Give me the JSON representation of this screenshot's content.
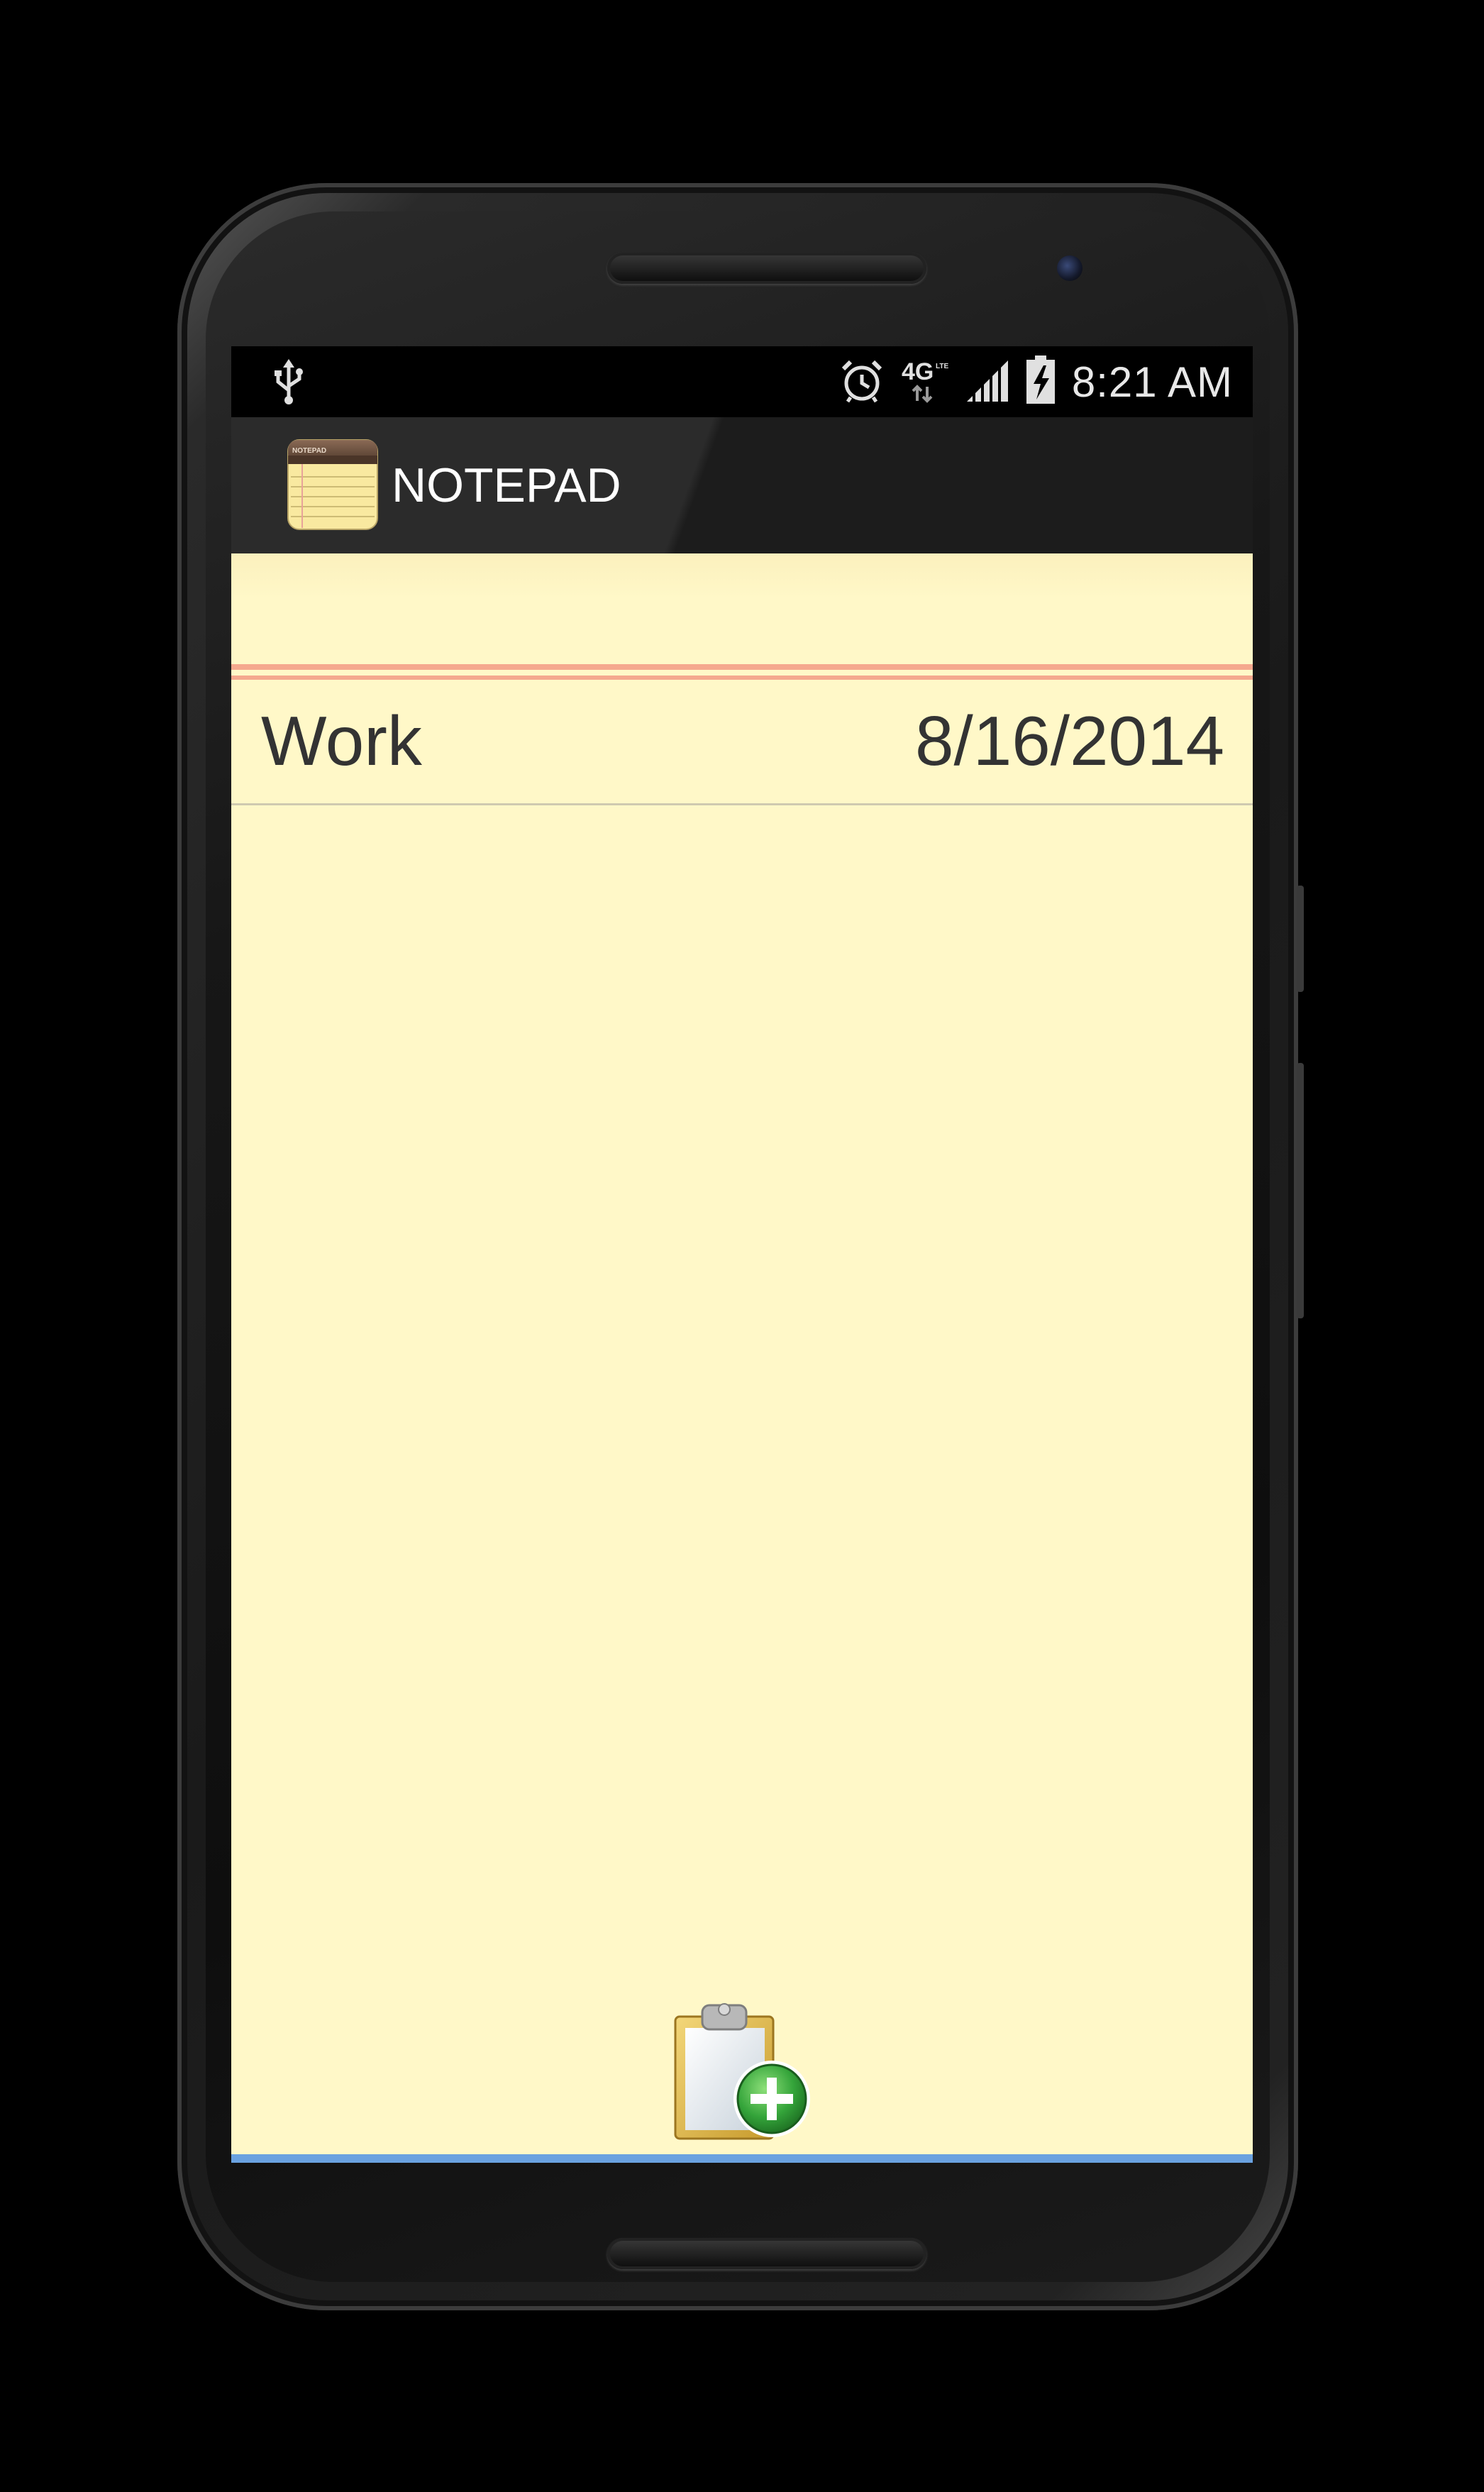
{
  "status_bar": {
    "time": "8:21 AM",
    "network": "4G LTE",
    "icons": [
      "usb-icon",
      "alarm-icon",
      "4g-lte-icon",
      "signal-icon",
      "battery-charging-icon"
    ]
  },
  "action_bar": {
    "title": "NOTEPAD",
    "icon": "notepad-app-icon",
    "icon_label": "NOTEPAD"
  },
  "notes": [
    {
      "title": "Work",
      "date": "8/16/2014"
    }
  ],
  "add_note": {
    "icon": "clipboard-add-icon"
  },
  "colors": {
    "paper": "#fff8c8",
    "margin_rule": "#f5a88e",
    "accent_line": "#6aa2e0",
    "text": "#333333"
  }
}
